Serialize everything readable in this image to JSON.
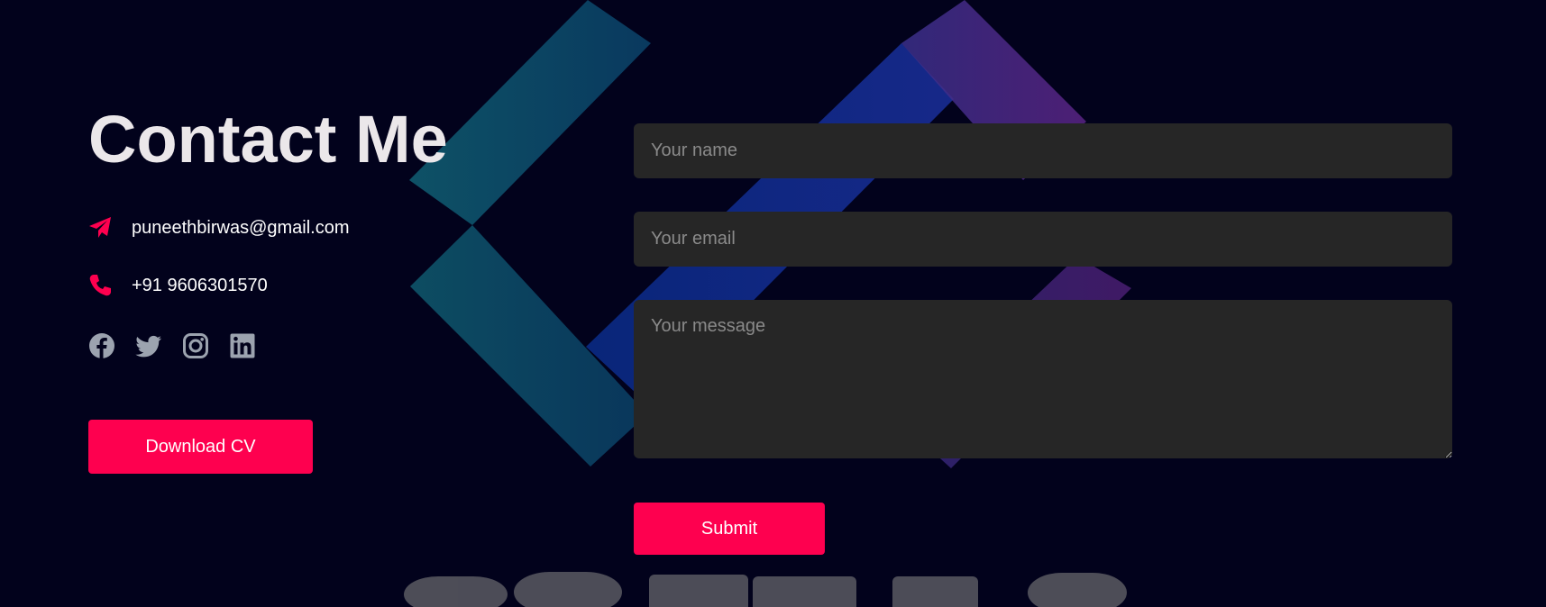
{
  "contact": {
    "title": "Contact Me",
    "email": "puneethbirwas@gmail.com",
    "phone": "+91 9606301570",
    "download_label": "Download CV"
  },
  "socials": [
    {
      "icon": "facebook-icon"
    },
    {
      "icon": "twitter-icon"
    },
    {
      "icon": "instagram-icon"
    },
    {
      "icon": "linkedin-icon"
    }
  ],
  "form": {
    "name_placeholder": "Your name",
    "email_placeholder": "Your email",
    "message_placeholder": "Your message",
    "submit_label": "Submit"
  },
  "colors": {
    "accent": "#fe004f",
    "background": "#02021c",
    "field_bg": "#262626",
    "title": "#ebe7ea",
    "social_icon": "#9ca3af"
  }
}
